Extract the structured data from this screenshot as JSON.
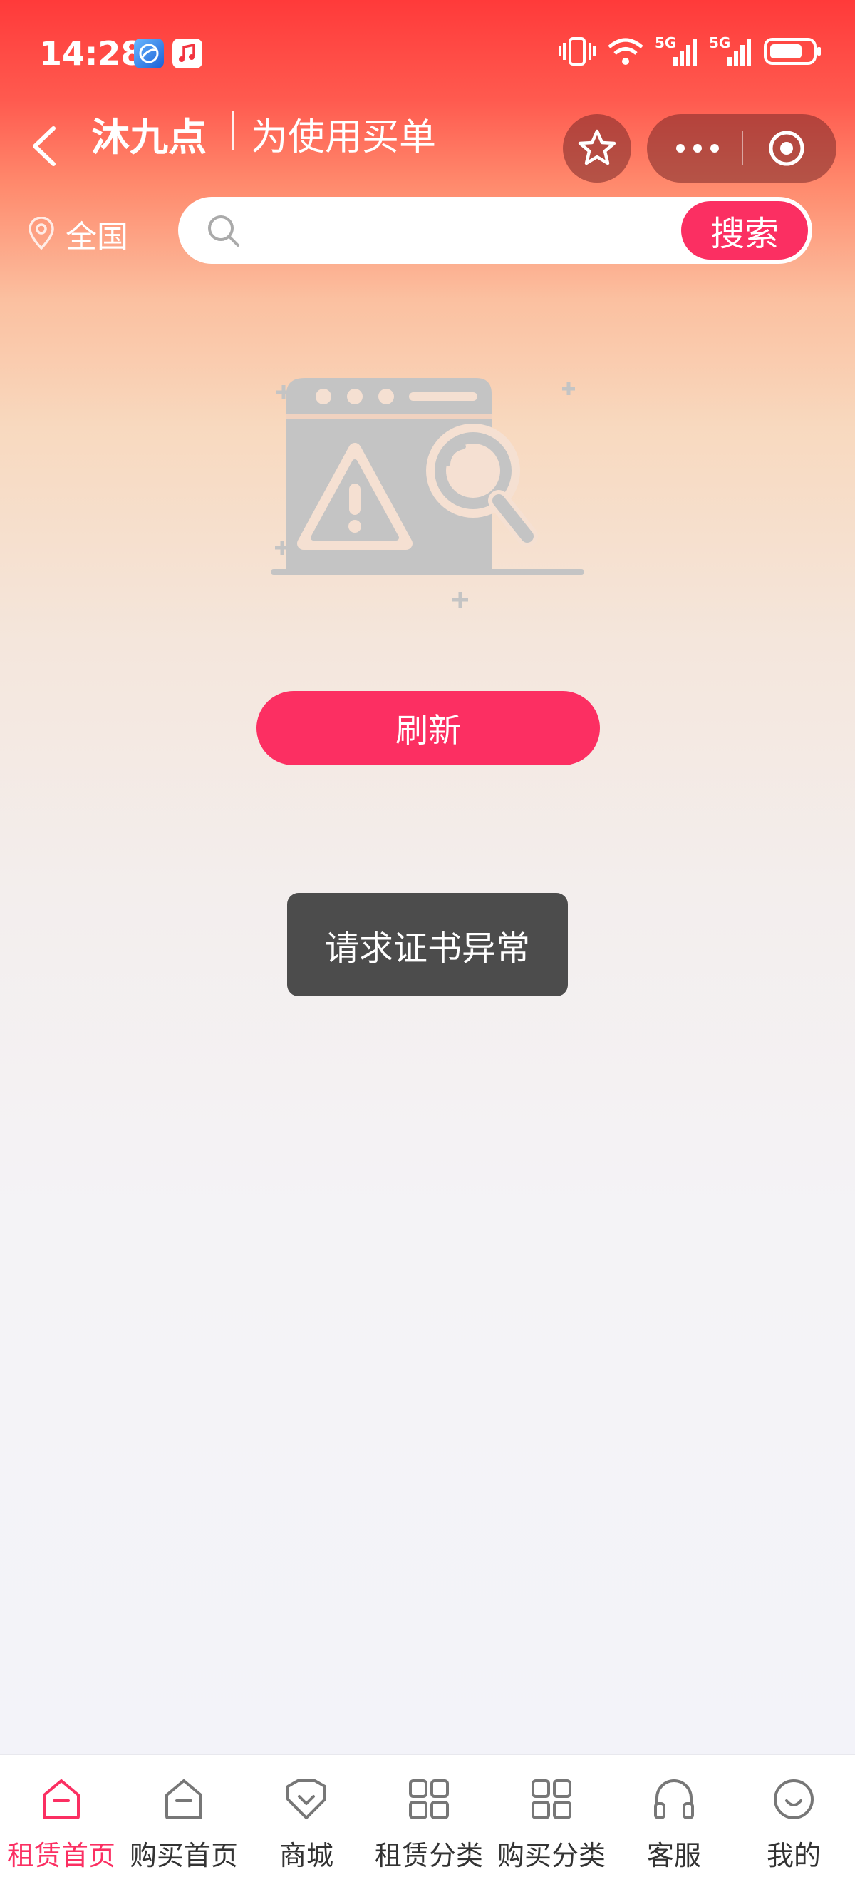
{
  "status_bar": {
    "time": "14:28",
    "network_1": "5G",
    "network_2": "5G"
  },
  "nav": {
    "title": "沐九点",
    "subtitle": "为使用买单"
  },
  "location": {
    "label": "全国"
  },
  "search": {
    "placeholder": "",
    "button_label": "搜索"
  },
  "main": {
    "refresh_label": "刷新",
    "toast": "请求证书异常"
  },
  "tabs": [
    {
      "label": "租赁首页",
      "icon": "home-icon",
      "active": true
    },
    {
      "label": "购买首页",
      "icon": "home-icon",
      "active": false
    },
    {
      "label": "商城",
      "icon": "shop-icon",
      "active": false
    },
    {
      "label": "租赁分类",
      "icon": "grid-icon",
      "active": false
    },
    {
      "label": "购买分类",
      "icon": "grid-icon",
      "active": false
    },
    {
      "label": "客服",
      "icon": "headset-icon",
      "active": false
    },
    {
      "label": "我的",
      "icon": "smile-icon",
      "active": false
    }
  ],
  "colors": {
    "accent": "#fb2f62",
    "header_top": "#ff3a3a",
    "toast_bg": "#4c4c4c"
  }
}
